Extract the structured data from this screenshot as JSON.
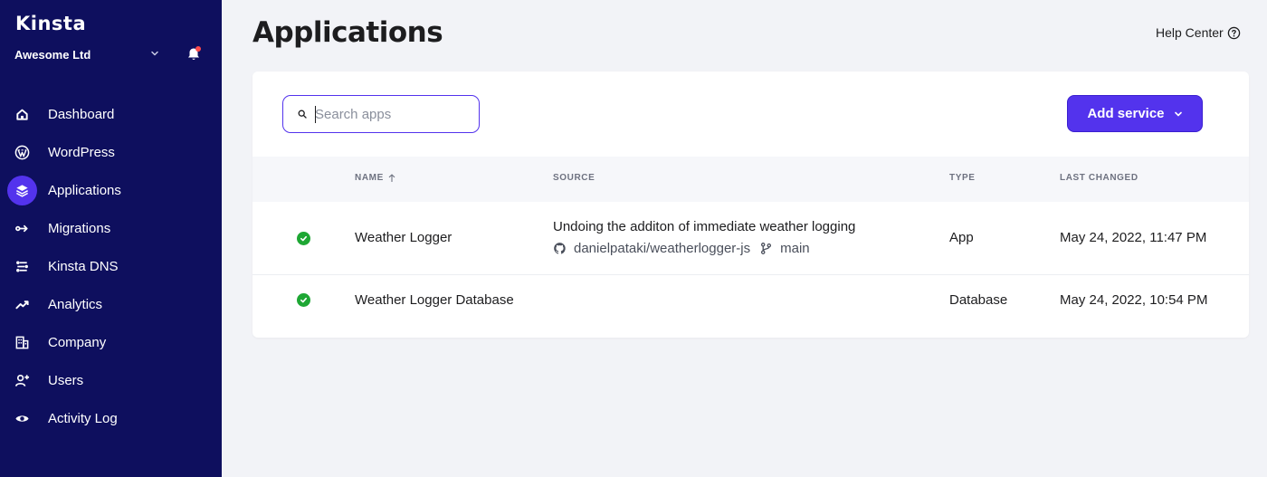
{
  "sidebar": {
    "logo": "Kinsta",
    "org_name": "Awesome Ltd",
    "items": [
      {
        "label": "Dashboard",
        "icon": "home-icon"
      },
      {
        "label": "WordPress",
        "icon": "wordpress-icon"
      },
      {
        "label": "Applications",
        "icon": "layers-icon",
        "active": true
      },
      {
        "label": "Migrations",
        "icon": "migrations-icon"
      },
      {
        "label": "Kinsta DNS",
        "icon": "dns-icon"
      },
      {
        "label": "Analytics",
        "icon": "analytics-icon"
      },
      {
        "label": "Company",
        "icon": "company-icon"
      },
      {
        "label": "Users",
        "icon": "user-add-icon"
      },
      {
        "label": "Activity Log",
        "icon": "eye-icon"
      }
    ]
  },
  "header": {
    "title": "Applications",
    "help_label": "Help Center"
  },
  "toolbar": {
    "search_placeholder": "Search apps",
    "search_value": "",
    "add_label": "Add service"
  },
  "table": {
    "columns": [
      "NAME",
      "SOURCE",
      "TYPE",
      "LAST CHANGED"
    ],
    "rows": [
      {
        "status": "success",
        "name": "Weather Logger",
        "source_commit": "Undoing the additon of immediate weather logging",
        "source_repo": "danielpataki/weatherlogger-js",
        "source_branch": "main",
        "type": "App",
        "last_changed": "May 24, 2022, 11:47 PM"
      },
      {
        "status": "success",
        "name": "Weather Logger Database",
        "type": "Database",
        "last_changed": "May 24, 2022, 10:54 PM"
      }
    ]
  },
  "colors": {
    "sidebar_bg": "#0e0f5e",
    "accent": "#5333ed",
    "success": "#1ea734",
    "page_bg": "#f2f3f7"
  }
}
